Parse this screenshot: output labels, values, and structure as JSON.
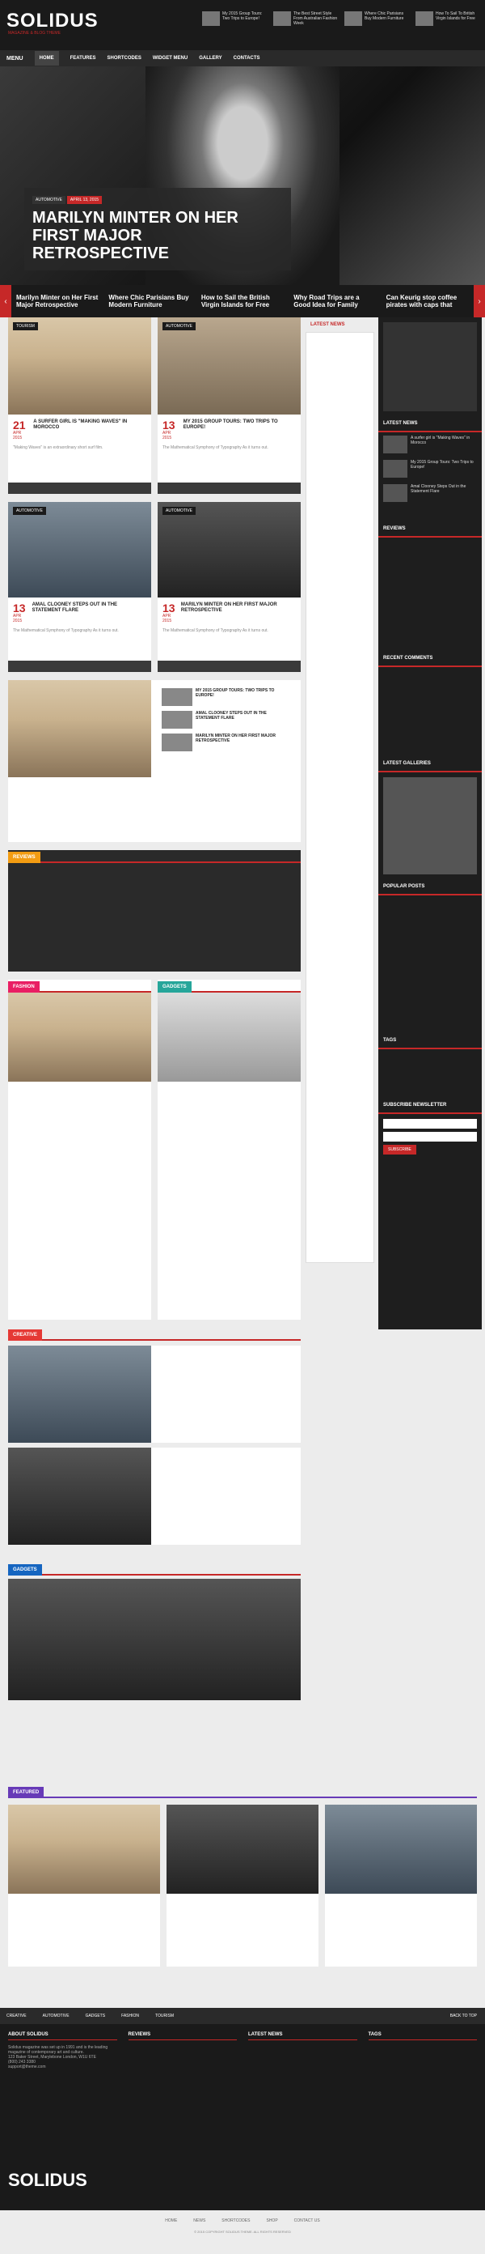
{
  "header": {
    "logo": "SOLIDUS",
    "tagline": "MAGAZINE & BLOG THEME",
    "posts": [
      "The Best Street Style From Australian Fashion Week",
      "How To Sail To British Virgin Islands for Free",
      "Where Chic Parisians Buy Modern Furniture",
      "My 2015 Group Tours: Two Trips to Europe!"
    ]
  },
  "nav": {
    "menu": "MENU",
    "items": [
      "HOME",
      "FEATURES",
      "SHORTCODES",
      "WIDGET MENU",
      "GALLERY",
      "CONTACTS"
    ]
  },
  "hero": {
    "tag": "AUTOMOTIVE",
    "date": "APRIL 13, 2015",
    "title": "MARILYN MINTER ON HER FIRST MAJOR RETROSPECTIVE"
  },
  "slider": [
    "Marilyn Minter on Her First Major Retrospective",
    "Where Chic Parisians Buy Modern Furniture",
    "How to Sail the British Virgin Islands for Free",
    "Why Road Trips are a Good Idea for Family",
    "Can Keurig stop coffee pirates with caps that"
  ],
  "cards": [
    {
      "cat": "TOURISM",
      "day": "21",
      "mon": "APR 2015",
      "title": "A SURFER GIRL IS \"MAKING WAVES\" IN MOROCCO",
      "excerpt": "\"Making Waves\" is an extraordinary short surf film."
    },
    {
      "cat": "AUTOMOTIVE",
      "day": "13",
      "mon": "APR 2015",
      "title": "MY 2015 GROUP TOURS: TWO TRIPS TO EUROPE!",
      "excerpt": "The Mathematical Symphony of Typography As it turns out."
    },
    {
      "cat": "AUTOMOTIVE",
      "day": "13",
      "mon": "APR 2015",
      "title": "AMAL CLOONEY STEPS OUT IN THE STATEMENT FLARE",
      "excerpt": "The Mathematical Symphony of Typography As it turns out."
    },
    {
      "cat": "AUTOMOTIVE",
      "day": "13",
      "mon": "APR 2015",
      "title": "MARILYN MINTER ON HER FIRST MAJOR RETROSPECTIVE",
      "excerpt": "The Mathematical Symphony of Typography As it turns out."
    }
  ],
  "sections": {
    "reviews": "REVIEWS",
    "fashion": "FASHION",
    "gadgets": "GADGETS",
    "creative": "CREATIVE",
    "gadgets2": "GADGETS",
    "featured": "FEATURED"
  },
  "sidebar": {
    "latest": "LATEST NEWS",
    "reviews": "REVIEWS",
    "recent": "RECENT COMMENTS",
    "gallery": "LATEST GALLERIES",
    "popular": "POPULAR POSTS",
    "tags": "TAGS",
    "subscribe": "SUBSCRIBE NEWSLETTER",
    "subscribe_btn": "SUBSCRIBE",
    "latest_posts": [
      "A surfer girl is \"Making Waves\" in Morocco",
      "My 2015 Group Tours: Two Trips to Europe!",
      "Amal Clooney Steps Out in the Statement Flare"
    ]
  },
  "footer": {
    "nav": [
      "CREATIVE",
      "AUTOMOTIVE",
      "GADGETS",
      "FASHION",
      "TOURISM"
    ],
    "back": "BACK TO TOP",
    "about": "ABOUT SOLIDUS",
    "reviews": "REVIEWS",
    "latest": "LATEST NEWS",
    "tags": "TAGS",
    "about_text": "Solidus magazine was set up in 1991 and is the leading magazine of contemporary art and culture.",
    "address": "123 Baker Street, Marylebone London, W1U 6TE",
    "phone": "(800) 243 3380",
    "email": "support@theme.com",
    "logo": "SOLIDUS",
    "links": [
      "HOME",
      "NEWS",
      "SHORTCODES",
      "SHOP",
      "CONTACT US"
    ],
    "copyright": "© 2015 COPYRIGHT SOLIDUS THEME. ALL RIGHTS RESERVED"
  }
}
